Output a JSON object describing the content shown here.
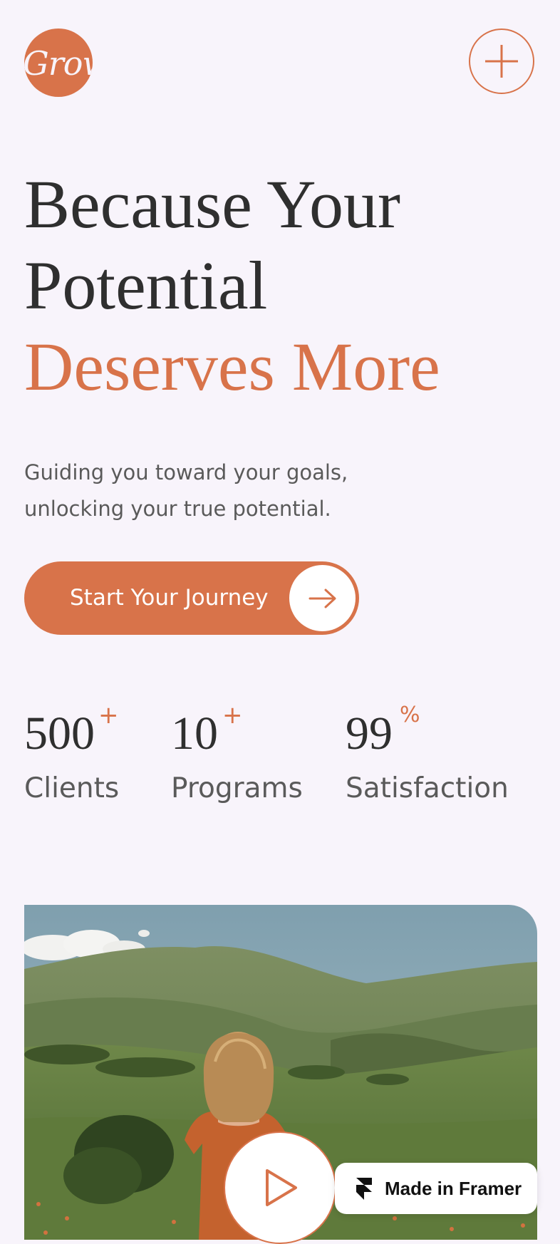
{
  "brand": {
    "logo_text": "Grow",
    "accent_color": "#D8734A",
    "background": "#F8F4FB"
  },
  "header": {
    "menu_icon": "plus-icon"
  },
  "hero": {
    "headline_line1": "Because Your",
    "headline_line2": "Potential",
    "headline_accent": "Deserves More",
    "subtitle_line1": "Guiding you toward your goals,",
    "subtitle_line2": "unlocking your true potential."
  },
  "cta": {
    "label": "Start Your Journey",
    "icon": "arrow-right-icon"
  },
  "stats": [
    {
      "value": "500",
      "suffix": "+",
      "label": "Clients"
    },
    {
      "value": "10",
      "suffix": "+",
      "label": "Programs"
    },
    {
      "value": "99",
      "suffix": "%",
      "label": "Satisfaction"
    }
  ],
  "media": {
    "play_icon": "play-icon"
  },
  "badge": {
    "label": "Made in Framer",
    "icon": "framer-logo-icon"
  }
}
